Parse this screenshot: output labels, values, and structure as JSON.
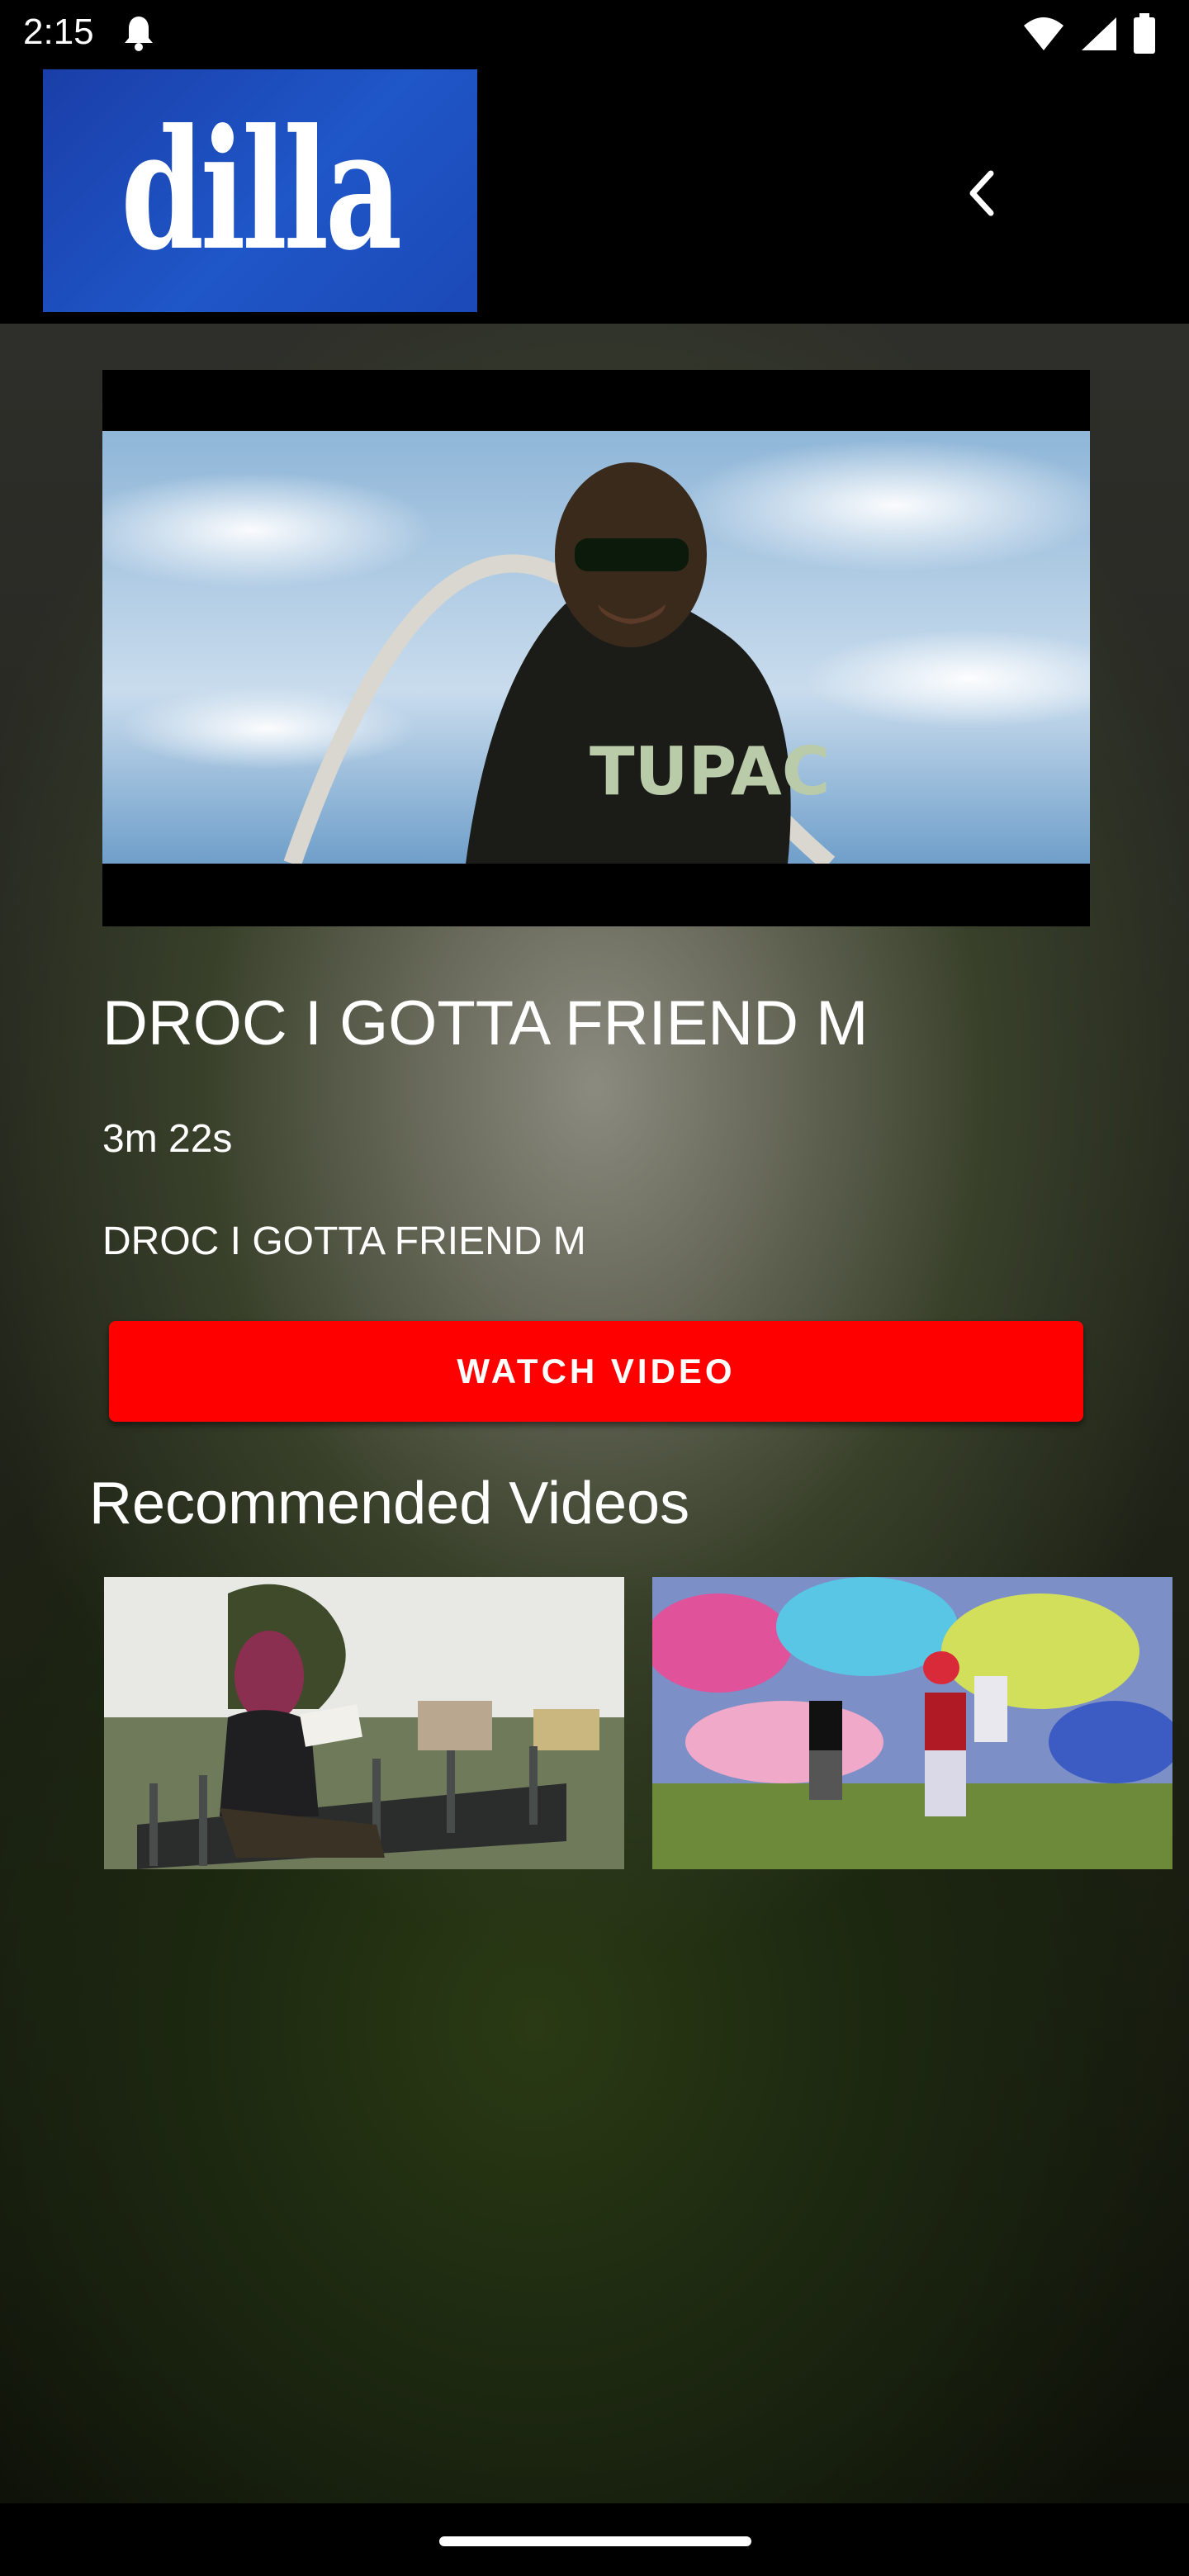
{
  "status_bar": {
    "time": "2:15",
    "icons": [
      "notification-bell-icon",
      "wifi-icon",
      "signal-icon",
      "battery-icon"
    ]
  },
  "app_bar": {
    "logo_text": "dilla",
    "back_icon": "chevron-left-icon",
    "logo_color": "#1f56c8"
  },
  "video": {
    "title": "DROC I GOTTA FRIEND M",
    "duration": "3m 22s",
    "description": "DROC I GOTTA FRIEND M",
    "shirt_text": "TUPAC"
  },
  "actions": {
    "watch_label": "WATCH VIDEO",
    "watch_color": "#ff0000"
  },
  "recommended": {
    "heading": "Recommended Videos",
    "items": [
      {
        "thumbnail": "woman-on-bench"
      },
      {
        "thumbnail": "kids-by-graffiti-wall"
      }
    ]
  }
}
